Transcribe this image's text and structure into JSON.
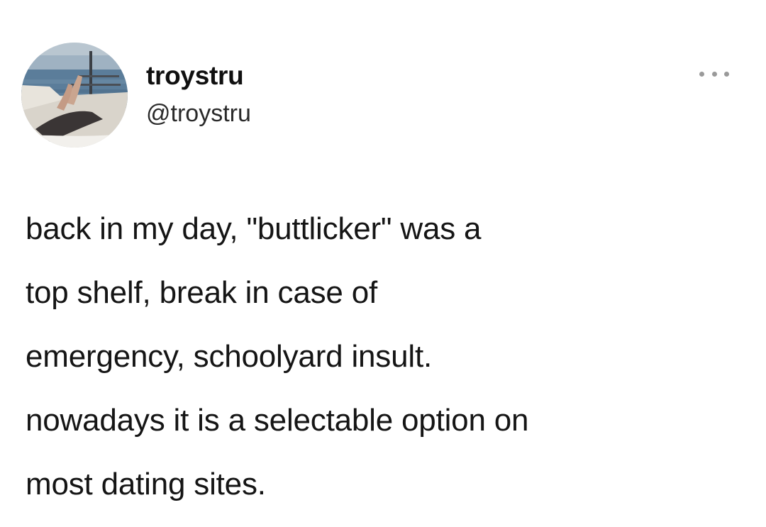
{
  "author": {
    "display_name": "troystru",
    "handle": "@troystru",
    "avatar_icon": "profile-photo-boat-deck"
  },
  "tweet": {
    "lines": [
      "back in my day, \"buttlicker\" was a",
      "top shelf, break in case of",
      "emergency, schoolyard insult.",
      "nowadays it is a selectable option on",
      "most dating sites."
    ]
  },
  "actions": {
    "more_icon": "more-options-icon"
  },
  "colors": {
    "background": "#ffffff",
    "text": "#151515",
    "muted": "#9a9a9a"
  }
}
